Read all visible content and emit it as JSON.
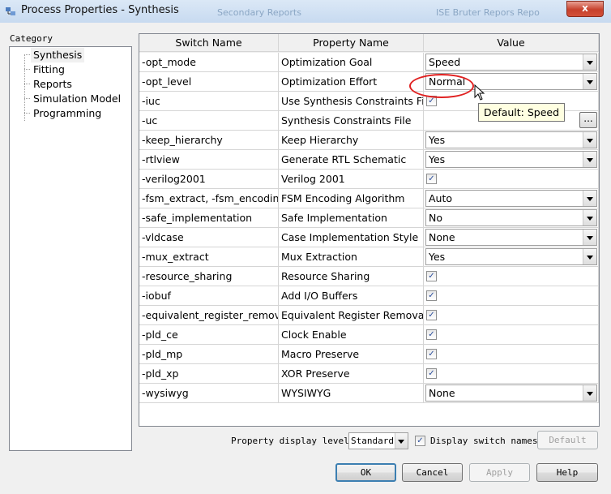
{
  "window": {
    "title": "Process Properties - Synthesis",
    "close_label": "x",
    "background_text_1": "Secondary Reports",
    "background_text_2": "ISE Bruter Repors Repo"
  },
  "category": {
    "label": "Category",
    "items": [
      "Synthesis",
      "Fitting",
      "Reports",
      "Simulation Model",
      "Programming"
    ],
    "selected": "Synthesis"
  },
  "grid": {
    "headers": [
      "Switch Name",
      "Property Name",
      "Value"
    ],
    "rows": [
      {
        "switch": "-opt_mode",
        "property": "Optimization Goal",
        "type": "combo",
        "value": "Speed"
      },
      {
        "switch": "-opt_level",
        "property": "Optimization Effort",
        "type": "combo",
        "value": "Normal"
      },
      {
        "switch": "-iuc",
        "property": "Use Synthesis Constraints File",
        "type": "check",
        "checked": true
      },
      {
        "switch": "-uc",
        "property": "Synthesis Constraints File",
        "type": "browse",
        "value": "",
        "button": "..."
      },
      {
        "switch": "-keep_hierarchy",
        "property": "Keep Hierarchy",
        "type": "combo",
        "value": "Yes"
      },
      {
        "switch": "-rtlview",
        "property": "Generate RTL Schematic",
        "type": "combo",
        "value": "Yes"
      },
      {
        "switch": "-verilog2001",
        "property": "Verilog 2001",
        "type": "check",
        "checked": true
      },
      {
        "switch": "-fsm_extract, -fsm_encoding",
        "property": "FSM Encoding Algorithm",
        "type": "combo",
        "value": "Auto"
      },
      {
        "switch": "-safe_implementation",
        "property": "Safe Implementation",
        "type": "combo",
        "value": "No"
      },
      {
        "switch": "-vldcase",
        "property": "Case Implementation Style",
        "type": "combo",
        "value": "None"
      },
      {
        "switch": "-mux_extract",
        "property": "Mux Extraction",
        "type": "combo",
        "value": "Yes"
      },
      {
        "switch": "-resource_sharing",
        "property": "Resource Sharing",
        "type": "check",
        "checked": true
      },
      {
        "switch": "-iobuf",
        "property": "Add I/O Buffers",
        "type": "check",
        "checked": true
      },
      {
        "switch": "-equivalent_register_removal",
        "property": "Equivalent Register Removal",
        "type": "check",
        "checked": true
      },
      {
        "switch": "-pld_ce",
        "property": "Clock Enable",
        "type": "check",
        "checked": true
      },
      {
        "switch": "-pld_mp",
        "property": "Macro Preserve",
        "type": "check",
        "checked": true
      },
      {
        "switch": "-pld_xp",
        "property": "XOR Preserve",
        "type": "check",
        "checked": true
      },
      {
        "switch": "-wysiwyg",
        "property": "WYSIWYG",
        "type": "combo",
        "value": "None"
      }
    ]
  },
  "tooltip": {
    "text": "Default: Speed"
  },
  "annotation_color": "#e02020",
  "footer": {
    "display_level_label": "Property display level:",
    "display_level_value": "Standard",
    "display_switch_label": "Display switch names",
    "display_switch_checked": true,
    "default_button": "Default"
  },
  "buttons": {
    "ok": "OK",
    "cancel": "Cancel",
    "apply": "Apply",
    "help": "Help"
  }
}
